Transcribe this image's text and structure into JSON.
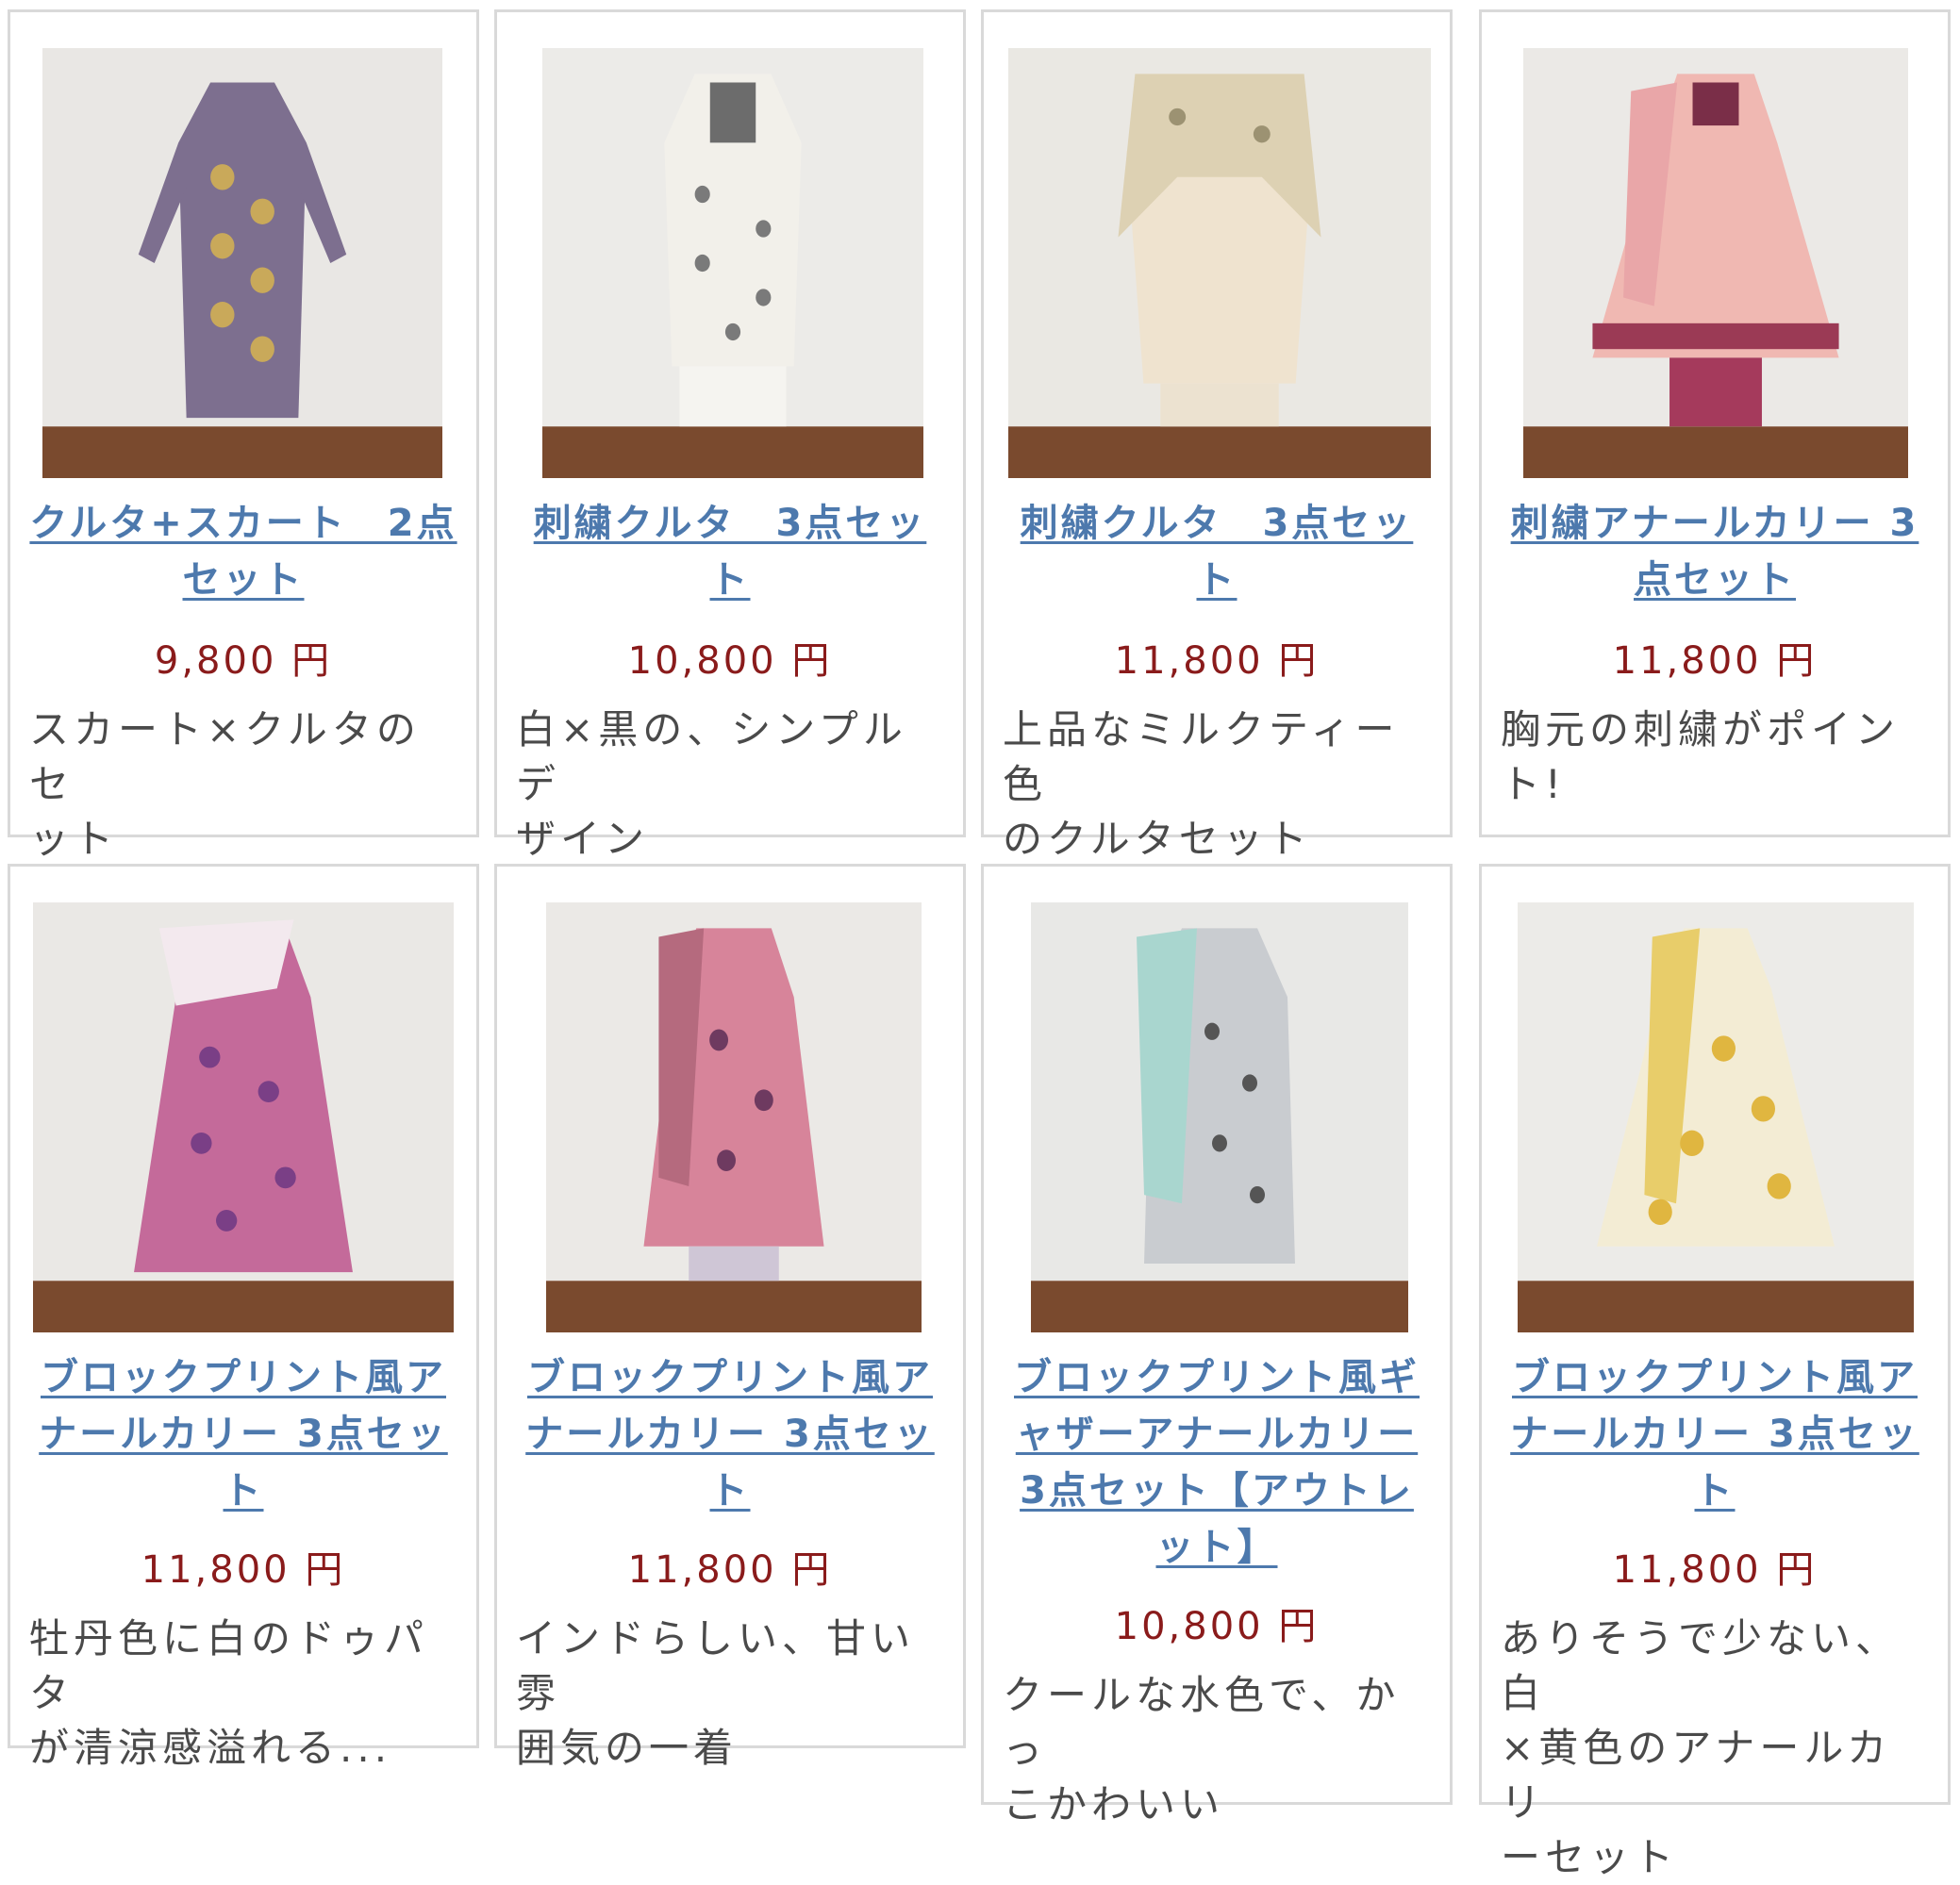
{
  "products": [
    {
      "title": "クルタ+スカート　2点\nセット",
      "price": "9,800 円",
      "description": "スカート×クルタのセ\nット",
      "image_alt": "kurta-skirt-photo"
    },
    {
      "title": "刺繍クルタ　3点セッ\nト",
      "price": "10,800 円",
      "description": "白×黒の、シンプルデ\nザイン",
      "image_alt": "embroidered-kurta-white-photo"
    },
    {
      "title": "刺繍クルタ　3点セッ\nト",
      "price": "11,800 円",
      "description": "上品なミルクティー色\nのクルタセット",
      "image_alt": "embroidered-kurta-beige-photo"
    },
    {
      "title": "刺繍アナールカリー 3\n点セット",
      "price": "11,800 円",
      "description": "胸元の刺繍がポイン\nト!",
      "image_alt": "embroidered-anarkali-pink-photo"
    },
    {
      "title": "ブロックプリント風ア\nナールカリー 3点セッ\nト",
      "price": "11,800 円",
      "description": "牡丹色に白のドゥパタ\nが清涼感溢れる...",
      "image_alt": "block-print-anarkali-magenta-photo"
    },
    {
      "title": "ブロックプリント風ア\nナールカリー 3点セッ\nト",
      "price": "11,800 円",
      "description": "インドらしい、甘い雰\n囲気の一着",
      "image_alt": "block-print-anarkali-pink-photo"
    },
    {
      "title": "ブロックプリント風ギ\nャザーアナールカリー\n3点セット【アウトレ\nット】",
      "price": "10,800 円",
      "description": "クールな水色で、かっ\nこかわいい",
      "image_alt": "block-print-gather-anarkali-blue-photo"
    },
    {
      "title": "ブロックプリント風ア\nナールカリー 3点セッ\nト",
      "price": "11,800 円",
      "description": "ありそうで少ない、白\n×黄色のアナールカリ\nーセット",
      "image_alt": "block-print-anarkali-yellow-photo"
    }
  ],
  "colors": {
    "link": "#4d79ad",
    "price": "#8a1b1b",
    "text": "#4a4a4a",
    "border": "#d9d9d9"
  }
}
